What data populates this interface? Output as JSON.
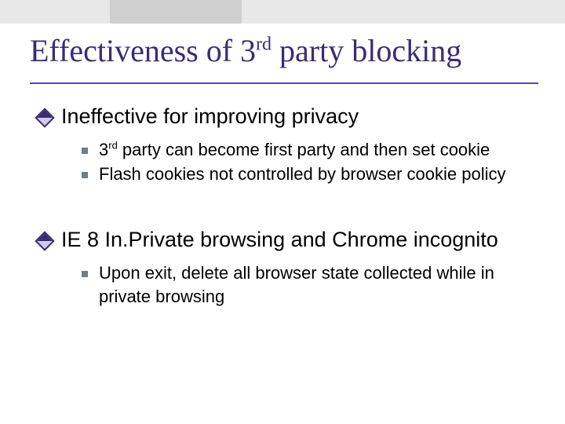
{
  "title": {
    "pre": "Effectiveness of 3",
    "sup": "rd",
    "post": " party blocking"
  },
  "bullets": [
    {
      "text": "Ineffective for improving privacy",
      "sub": [
        {
          "pre": "3",
          "sup": "rd",
          "post": " party can become first party and then set cookie"
        },
        {
          "pre": "Flash cookies not controlled by browser cookie policy",
          "sup": "",
          "post": ""
        }
      ]
    },
    {
      "text": "IE 8 In.Private browsing and Chrome incognito",
      "sub": [
        {
          "pre": "Upon exit,  delete all browser state collected while in private browsing",
          "sup": "",
          "post": ""
        }
      ]
    }
  ]
}
